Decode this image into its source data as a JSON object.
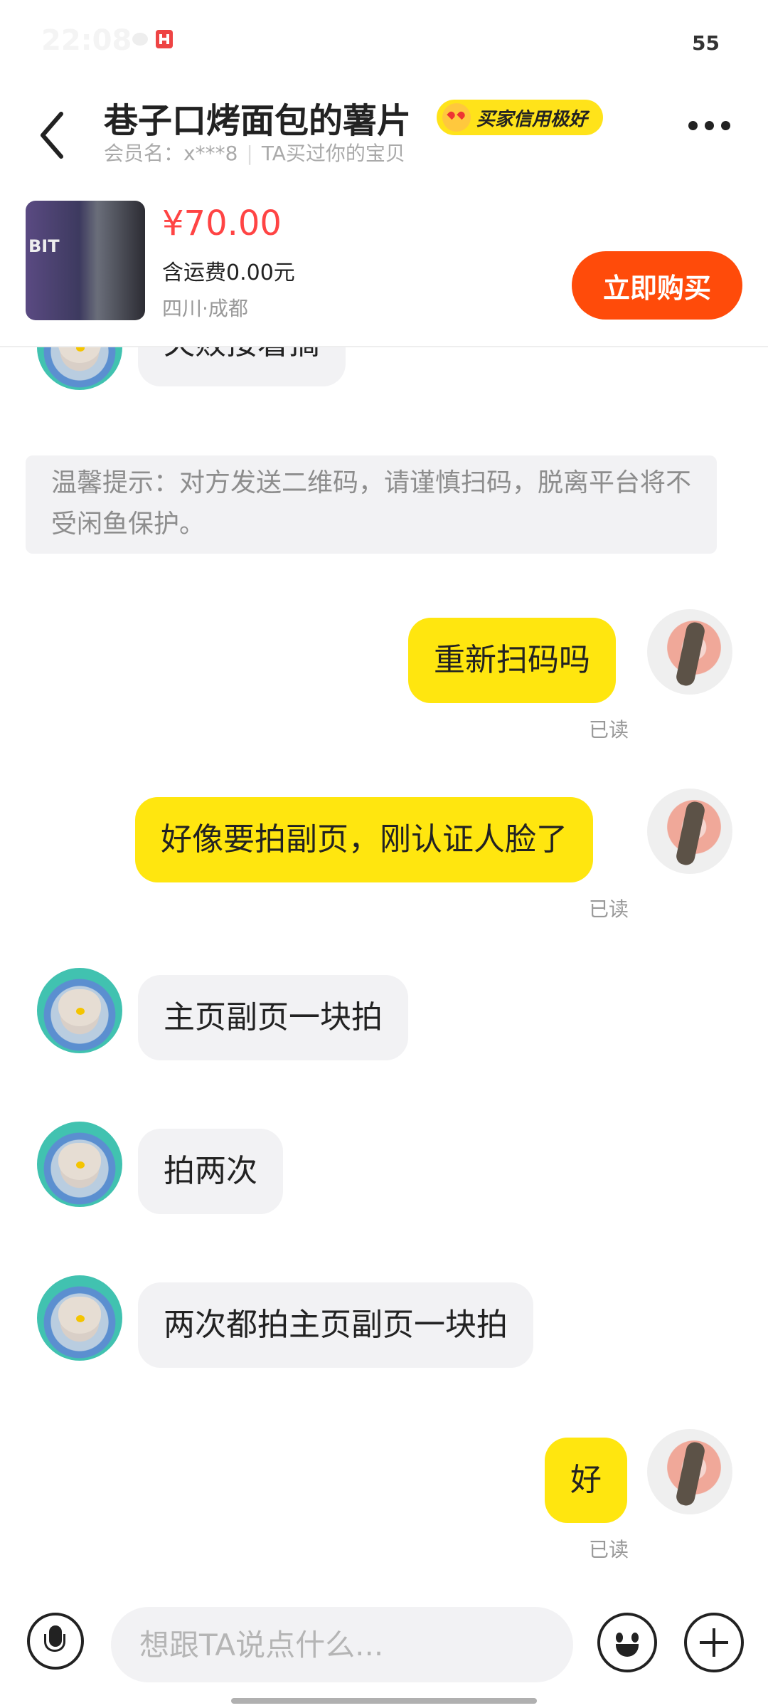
{
  "status_bar": {
    "time": "22:08",
    "battery": "55"
  },
  "header": {
    "title": "巷子口烤面包的薯片",
    "badge": "买家信用极好",
    "member_label": "会员名：x***8",
    "relation": "TA买过你的宝贝"
  },
  "product": {
    "image_text": "BIT",
    "price": "¥70.00",
    "shipping": "含运费0.00元",
    "location": "四川·成都",
    "buy_label": "立即购买"
  },
  "chat": {
    "partial_message": "失败接着搞",
    "notice": "温馨提示：对方发送二维码，请谨慎扫码，脱离平台将不受闲鱼保护。",
    "messages": [
      {
        "side": "right",
        "text": "重新扫码吗",
        "status": "已读"
      },
      {
        "side": "right",
        "text": "好像要拍副页，刚认证人脸了",
        "status": "已读"
      },
      {
        "side": "left",
        "text": "主页副页一块拍"
      },
      {
        "side": "left",
        "text": "拍两次"
      },
      {
        "side": "left",
        "text": "两次都拍主页副页一块拍"
      },
      {
        "side": "right",
        "text": "好",
        "status": "已读"
      }
    ]
  },
  "input": {
    "placeholder": "想跟TA说点什么..."
  },
  "icons": [
    "back-icon",
    "more-icon",
    "mic-icon",
    "emoji-icon",
    "plus-icon"
  ],
  "colors": {
    "accent_yellow": "#ffe60f",
    "buy_orange": "#ff4b0a",
    "price_red": "#ff4444"
  }
}
